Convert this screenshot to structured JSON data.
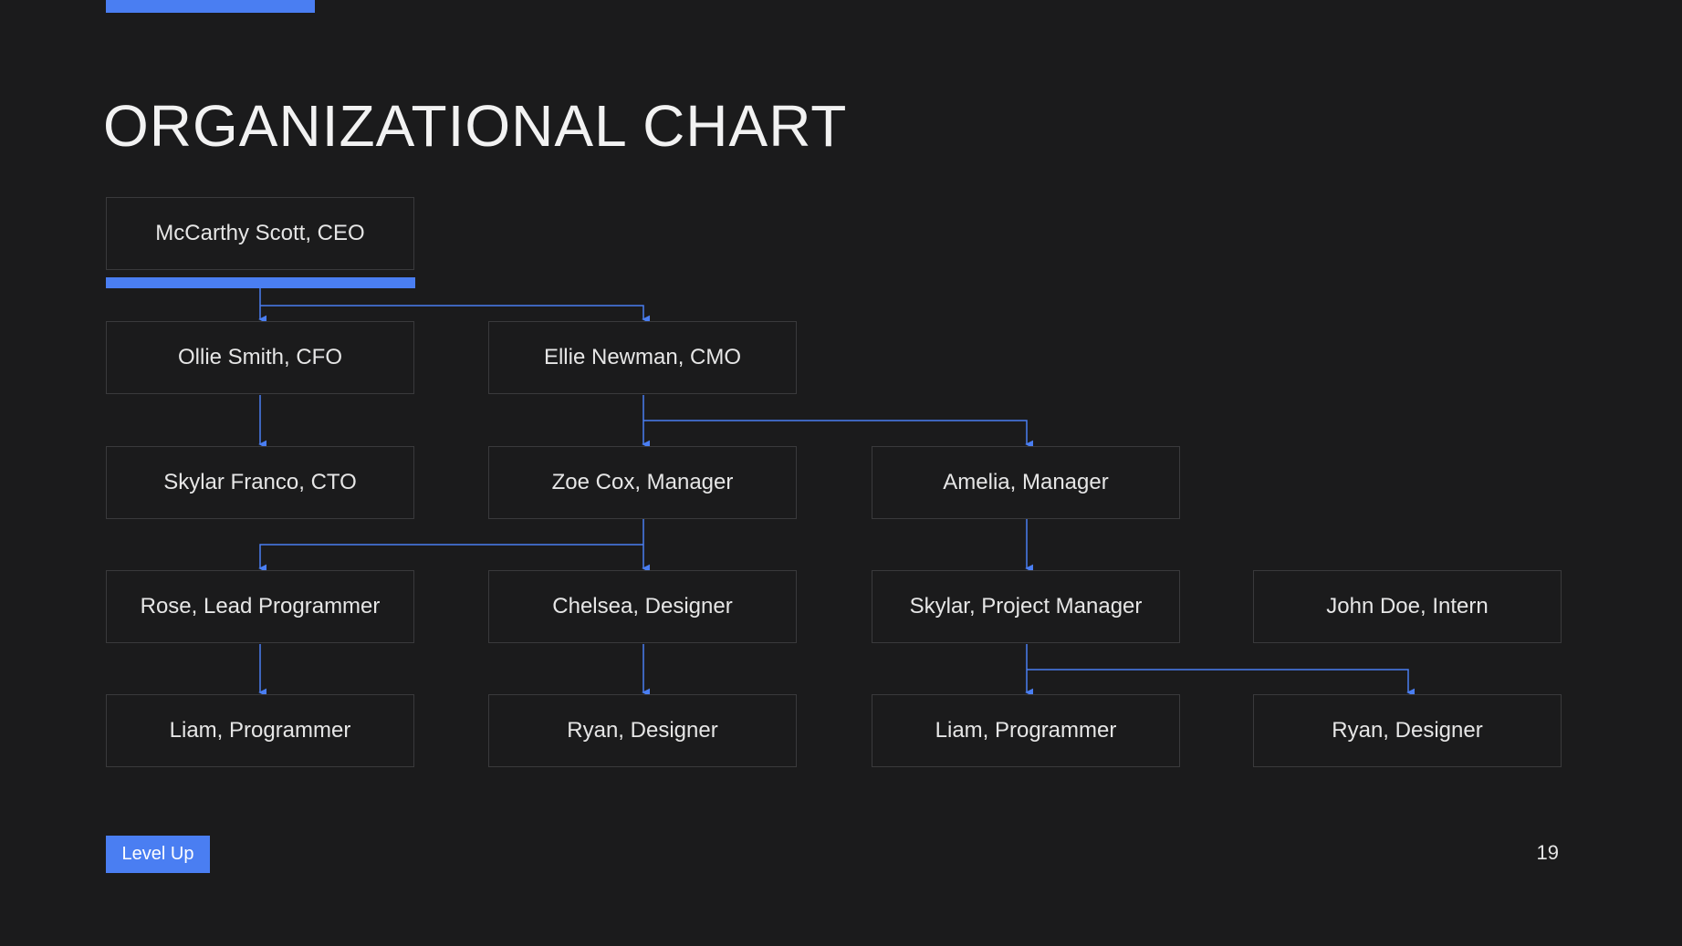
{
  "slide": {
    "title": "ORGANIZATIONAL CHART",
    "badge": "Level Up",
    "page_number": "19",
    "accent_color": "#4a7ef2",
    "background_color": "#1b1b1c"
  },
  "org": {
    "ceo": "McCarthy Scott, CEO",
    "cfo": "Ollie Smith, CFO",
    "cmo": "Ellie Newman, CMO",
    "cto": "Skylar Franco, CTO",
    "manager_zoe": "Zoe Cox, Manager",
    "manager_amelia": "Amelia, Manager",
    "lead_programmer": "Rose, Lead Programmer",
    "designer_chelsea": "Chelsea, Designer",
    "project_manager": "Skylar, Project Manager",
    "intern": "John Doe, Intern",
    "programmer_1": "Liam, Programmer",
    "designer_1": "Ryan, Designer",
    "programmer_2": "Liam, Programmer",
    "designer_2": "Ryan, Designer"
  }
}
